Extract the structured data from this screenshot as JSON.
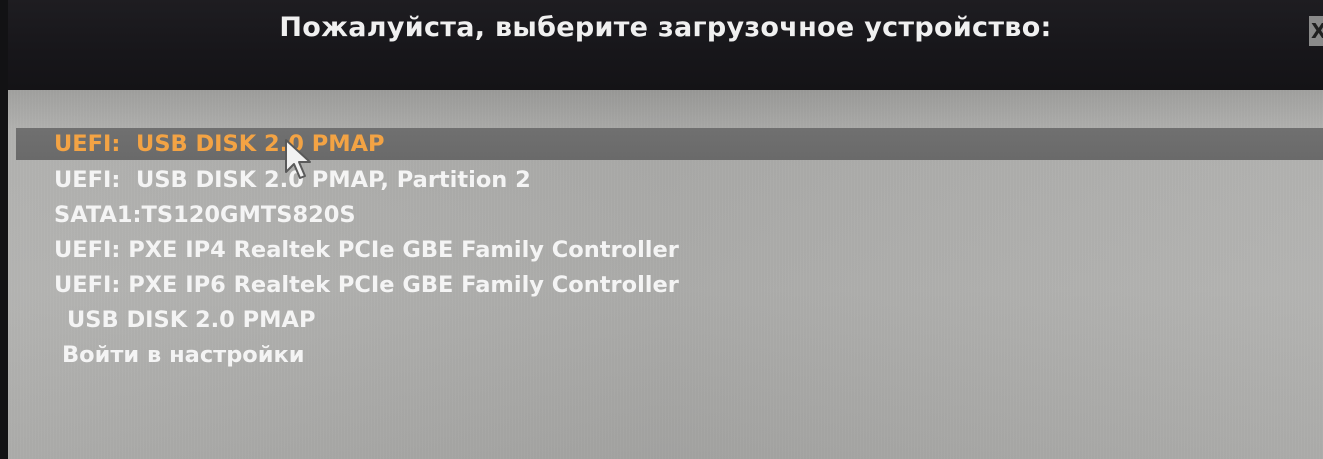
{
  "dialog": {
    "title": "Пожалуйста, выберите загрузочное устройство:",
    "close_label": "X"
  },
  "boot_devices": [
    {
      "label": "UEFI:  USB DISK 2.0 PMAP",
      "selected": true
    },
    {
      "label": "UEFI:  USB DISK 2.0 PMAP, Partition 2",
      "selected": false
    },
    {
      "label": "SATA1:TS120GMTS820S",
      "selected": false
    },
    {
      "label": "UEFI: PXE IP4 Realtek PCIe GBE Family Controller",
      "selected": false
    },
    {
      "label": "UEFI: PXE IP6 Realtek PCIe GBE Family Controller",
      "selected": false
    },
    {
      "label": "USB DISK 2.0 PMAP",
      "selected": false
    },
    {
      "label": "Войти в настройки",
      "selected": false
    }
  ],
  "colors": {
    "selected_text": "#f3a344",
    "normal_text": "#f4f4f4",
    "selection_bar": "#6e6e6e",
    "title_bar": "#18171b",
    "panel": "#acacaa"
  },
  "icons": {
    "pointer": "mouse-pointer-icon"
  }
}
